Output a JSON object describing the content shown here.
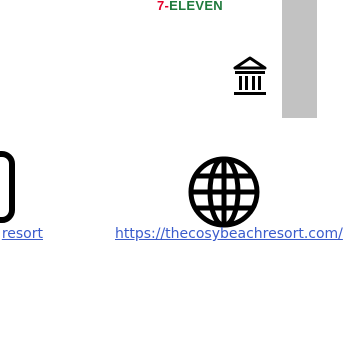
{
  "brand": {
    "prefix": "7-",
    "name": "ELEVEN"
  },
  "links": {
    "left_text": "resort",
    "right_text": "https://thecosybeachresort.com/"
  },
  "icons": {
    "top": "museum-icon",
    "left": "phone-frame-icon",
    "center": "globe-icon"
  },
  "colors": {
    "link": "#3a5ccc",
    "brand_red": "#e4002b",
    "brand_green": "#1f7a3c",
    "strip": "#c2c2c2"
  }
}
